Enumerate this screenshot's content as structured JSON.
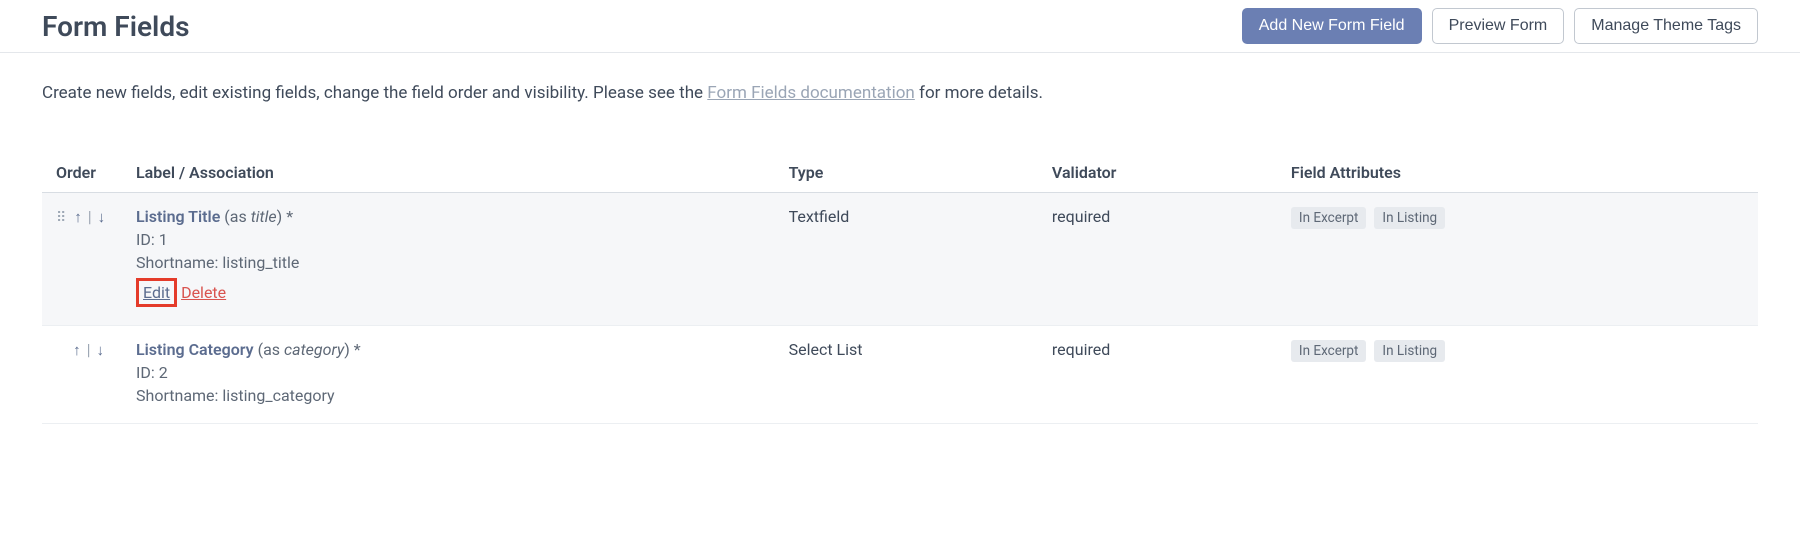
{
  "page_title": "Form Fields",
  "actions": {
    "add": "Add New Form Field",
    "preview": "Preview Form",
    "manage_tags": "Manage Theme Tags"
  },
  "intro": {
    "before": "Create new fields, edit existing fields, change the field order and visibility. Please see the ",
    "link_text": "Form Fields documentation",
    "after": " for more details."
  },
  "table": {
    "headers": {
      "order": "Order",
      "label": "Label / Association",
      "type": "Type",
      "validator": "Validator",
      "attributes": "Field Attributes"
    }
  },
  "rows": [
    {
      "label": "Listing Title",
      "as_prefix": "(as ",
      "as_alias": "title",
      "as_suffix": ")",
      "required_mark": "*",
      "id_text": "ID: 1",
      "shortname_text": "Shortname: listing_title",
      "edit": "Edit",
      "delete": "Delete",
      "type": "Textfield",
      "validator": "required",
      "badge1": "In Excerpt",
      "badge2": "In Listing"
    },
    {
      "label": "Listing Category",
      "as_prefix": "(as ",
      "as_alias": "category",
      "as_suffix": ")",
      "required_mark": "*",
      "id_text": "ID: 2",
      "shortname_text": "Shortname: listing_category",
      "type": "Select List",
      "validator": "required",
      "badge1": "In Excerpt",
      "badge2": "In Listing"
    }
  ]
}
